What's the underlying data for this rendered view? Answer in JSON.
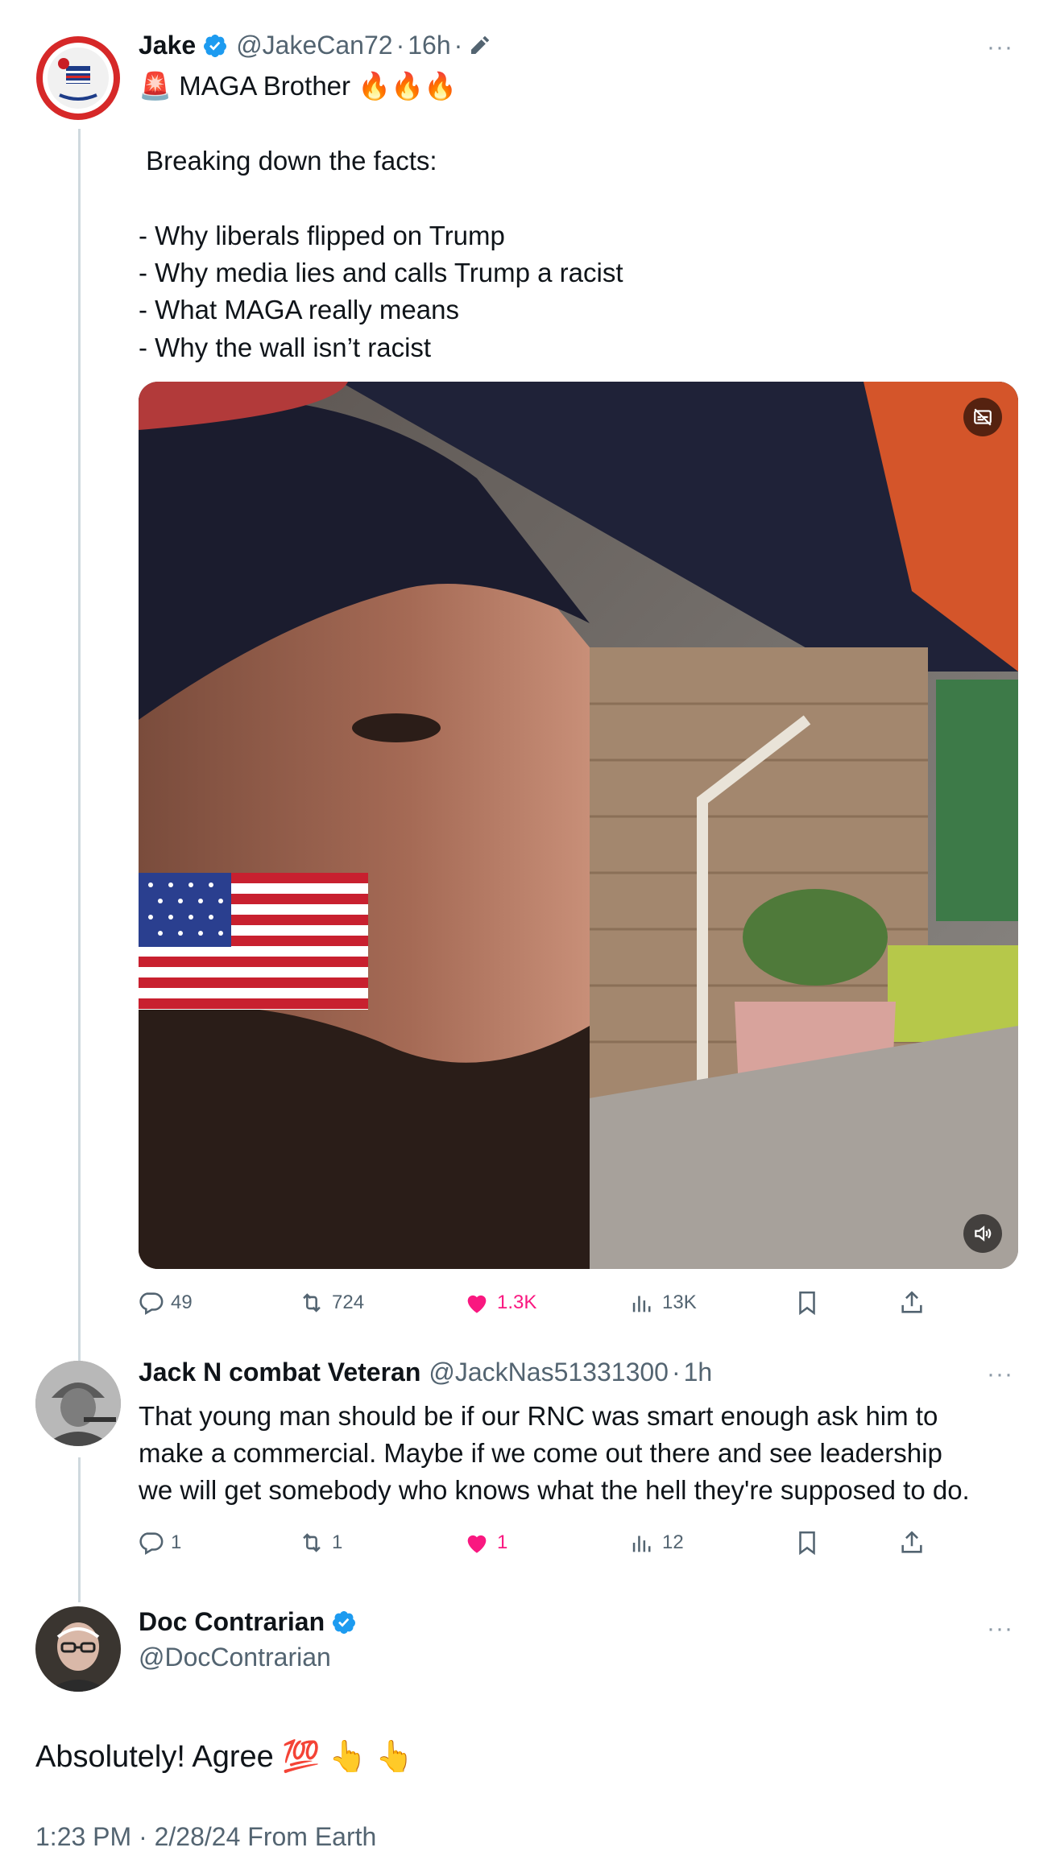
{
  "main_post": {
    "author_name": "Jake",
    "handle": "@JakeCan72",
    "separator": "·",
    "time": "16h",
    "separator_after": "·",
    "badge_emoji": "🚨",
    "subject": "MAGA Brother",
    "fire_emojis": "🔥🔥🔥",
    "body_lines": [
      " Breaking down the facts:",
      "",
      "- Why liberals flipped on Trump",
      "- Why media lies and calls Trump a racist",
      "- What MAGA really means",
      "- Why the wall isn’t racist"
    ],
    "media_badge_icon": "captions-icon",
    "media_mute_icon": "volume-icon",
    "stats": {
      "replies": "49",
      "reposts": "724",
      "likes": "1.3K",
      "views": "13K"
    }
  },
  "reply_1": {
    "author_name": "Jack N combat Veteran",
    "handle": "@JackNas51331300",
    "separator": "·",
    "time": "1h",
    "body_lines": [
      "That young man should be if our RNC was smart enough ask him to",
      "make a commercial. Maybe if we come out there and see leadership",
      "we will get somebody who knows what the hell they're supposed to do."
    ],
    "stats": {
      "replies": "1",
      "reposts": "1",
      "likes": "1",
      "views": "12"
    }
  },
  "focused_post": {
    "author_name": "Doc Contrarian",
    "handle": "@DocContrarian",
    "text": "Absolutely! Agree 💯 👆 👆",
    "timestamp": "1:23 PM · 2/28/24 From Earth"
  },
  "more_label": "···",
  "colors": {
    "text": "#0f1419",
    "secondary": "#536471",
    "like": "#f91880",
    "verified": "#1d9bf0",
    "thread_line": "#cfd9de"
  }
}
